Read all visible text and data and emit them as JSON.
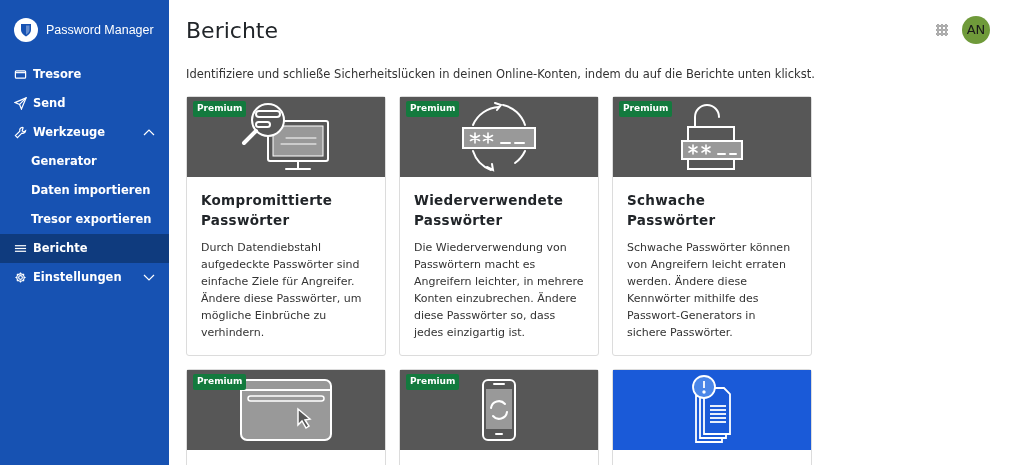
{
  "sidebar": {
    "brand": "Password Manager",
    "items": [
      {
        "label": "Tresore",
        "selected": false
      },
      {
        "label": "Send",
        "selected": false
      },
      {
        "label": "Werkzeuge",
        "selected": false,
        "expanded": true,
        "children": [
          {
            "label": "Generator",
            "selected": false
          },
          {
            "label": "Daten importieren",
            "selected": false
          },
          {
            "label": "Tresor exportieren",
            "selected": false
          }
        ]
      },
      {
        "label": "Berichte",
        "selected": true
      },
      {
        "label": "Einstellungen",
        "selected": false,
        "expanded": false
      }
    ]
  },
  "header": {
    "title": "Berichte",
    "avatar": "AN"
  },
  "intro": "Identifiziere und schließe Sicherheitslücken in deinen Online-Konten, indem du auf die Berichte unten klickst.",
  "reports": [
    {
      "kind": "exposed",
      "premium": true,
      "badge": "Premium",
      "title": "Kompromittierte Passwörter",
      "description": "Durch Datendiebstahl aufgedeckte Passwörter sind einfache Ziele für Angreifer. Ändere diese Passwörter, um mögliche Einbrüche zu verhindern."
    },
    {
      "kind": "reused",
      "premium": true,
      "badge": "Premium",
      "title": "Wiederverwendete Passwörter",
      "description": "Die Wiederverwendung von Passwörtern macht es Angreifern leichter, in mehrere Konten einzubrechen. Ändere diese Passwörter so, dass jedes einzigartig ist."
    },
    {
      "kind": "weak",
      "premium": true,
      "badge": "Premium",
      "title": "Schwache Passwörter",
      "description": "Schwache Passwörter können von Angreifern leicht erraten werden. Ändere diese Kennwörter mithilfe des Passwort-Generators in sichere Passwörter."
    },
    {
      "kind": "website",
      "premium": true,
      "badge": "Premium"
    },
    {
      "kind": "phone",
      "premium": true,
      "badge": "Premium"
    },
    {
      "kind": "breach",
      "premium": false
    }
  ]
}
